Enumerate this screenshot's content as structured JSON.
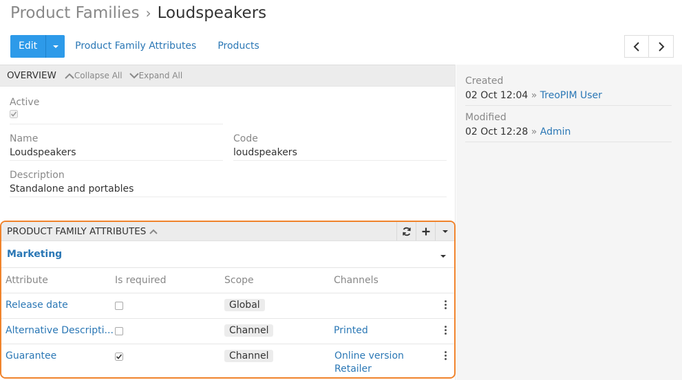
{
  "breadcrumb": {
    "parent": "Product Families",
    "separator": "›",
    "current": "Loudspeakers"
  },
  "toolbar": {
    "edit_label": "Edit",
    "links": [
      "Product Family Attributes",
      "Products"
    ]
  },
  "overview": {
    "title": "OVERVIEW",
    "collapse_label": "Collapse All",
    "expand_label": "Expand All",
    "fields": {
      "active": {
        "label": "Active",
        "checked": true
      },
      "name": {
        "label": "Name",
        "value": "Loudspeakers"
      },
      "code": {
        "label": "Code",
        "value": "loudspeakers"
      },
      "description": {
        "label": "Description",
        "value": "Standalone and portables"
      }
    }
  },
  "side": {
    "created": {
      "label": "Created",
      "date": "02 Oct 12:04",
      "arrow": "»",
      "user": "TreoPIM User"
    },
    "modified": {
      "label": "Modified",
      "date": "02 Oct 12:28",
      "arrow": "»",
      "user": "Admin"
    }
  },
  "pfa": {
    "title": "PRODUCT FAMILY ATTRIBUTES",
    "group": "Marketing",
    "columns": [
      "Attribute",
      "Is required",
      "Scope",
      "Channels"
    ],
    "rows": [
      {
        "attribute": "Release date",
        "required": false,
        "scope": "Global",
        "channels": []
      },
      {
        "attribute": "Alternative Descripti...",
        "required": false,
        "scope": "Channel",
        "channels": [
          "Printed"
        ]
      },
      {
        "attribute": "Guarantee",
        "required": true,
        "scope": "Channel",
        "channels": [
          "Online version",
          "Retailer"
        ]
      }
    ]
  },
  "colors": {
    "accent": "#2d9ae9",
    "link": "#2a77b5",
    "highlight": "#f0832b"
  }
}
